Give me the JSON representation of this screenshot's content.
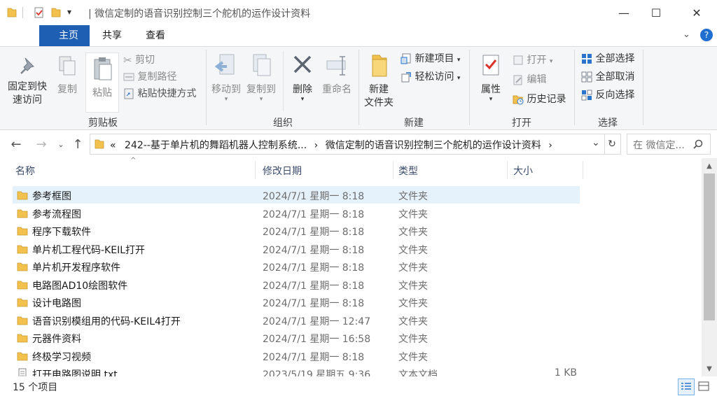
{
  "window": {
    "title": "| 微信定制的语音识别控制三个舵机的运作设计资料",
    "minimize": "—",
    "maximize": "☐",
    "close": "✕"
  },
  "ribbon_tabs": [
    "主页",
    "共享",
    "查看"
  ],
  "ribbon": {
    "clipboard": {
      "pin": "固定到快\n速访问",
      "copy": "复制",
      "paste": "粘贴",
      "cut": "剪切",
      "copy_path": "复制路径",
      "paste_shortcut": "粘贴快捷方式",
      "label": "剪贴板"
    },
    "organize": {
      "move_to": "移动到",
      "copy_to": "复制到",
      "delete": "删除",
      "rename": "重命名",
      "label": "组织"
    },
    "new": {
      "new_folder": "新建\n文件夹",
      "new_item": "新建项目",
      "easy_access": "轻松访问",
      "label": "新建"
    },
    "open": {
      "properties": "属性",
      "open": "打开",
      "edit": "编辑",
      "history": "历史记录",
      "label": "打开"
    },
    "select": {
      "select_all": "全部选择",
      "select_none": "全部取消",
      "invert": "反向选择",
      "label": "选择"
    }
  },
  "address": {
    "crumbs": [
      "«",
      "242--基于单片机的舞蹈机器人控制系统...",
      "›",
      "微信定制的语音识别控制三个舵机的运作设计资料",
      "›"
    ],
    "search_placeholder": "在 微信定..."
  },
  "columns": {
    "name": "名称",
    "date": "修改日期",
    "type": "类型",
    "size": "大小"
  },
  "files": [
    {
      "name": "参考框图",
      "date": "2024/7/1 星期一 8:18",
      "type": "文件夹",
      "size": "",
      "kind": "folder",
      "selected": true
    },
    {
      "name": "参考流程图",
      "date": "2024/7/1 星期一 8:18",
      "type": "文件夹",
      "size": "",
      "kind": "folder"
    },
    {
      "name": "程序下载软件",
      "date": "2024/7/1 星期一 8:18",
      "type": "文件夹",
      "size": "",
      "kind": "folder"
    },
    {
      "name": "单片机工程代码-KEIL打开",
      "date": "2024/7/1 星期一 8:18",
      "type": "文件夹",
      "size": "",
      "kind": "folder"
    },
    {
      "name": "单片机开发程序软件",
      "date": "2024/7/1 星期一 8:18",
      "type": "文件夹",
      "size": "",
      "kind": "folder"
    },
    {
      "name": "电路图AD10绘图软件",
      "date": "2024/7/1 星期一 8:18",
      "type": "文件夹",
      "size": "",
      "kind": "folder"
    },
    {
      "name": "设计电路图",
      "date": "2024/7/1 星期一 8:18",
      "type": "文件夹",
      "size": "",
      "kind": "folder"
    },
    {
      "name": "语音识别模组用的代码-KEIL4打开",
      "date": "2024/7/1 星期一 12:47",
      "type": "文件夹",
      "size": "",
      "kind": "folder"
    },
    {
      "name": "元器件资料",
      "date": "2024/7/1 星期一 16:58",
      "type": "文件夹",
      "size": "",
      "kind": "folder"
    },
    {
      "name": "终极学习视频",
      "date": "2024/7/1 星期一 8:18",
      "type": "文件夹",
      "size": "",
      "kind": "folder"
    },
    {
      "name": "打开电路图说明.txt",
      "date": "2023/5/19 星期五 9:36",
      "type": "文本文档",
      "size": "1 KB",
      "kind": "file"
    }
  ],
  "status": {
    "item_count": "15 个项目"
  },
  "colors": {
    "accent": "#1f5fb3",
    "folder": "#f2c14e",
    "selected_row": "#e5f1fb"
  }
}
